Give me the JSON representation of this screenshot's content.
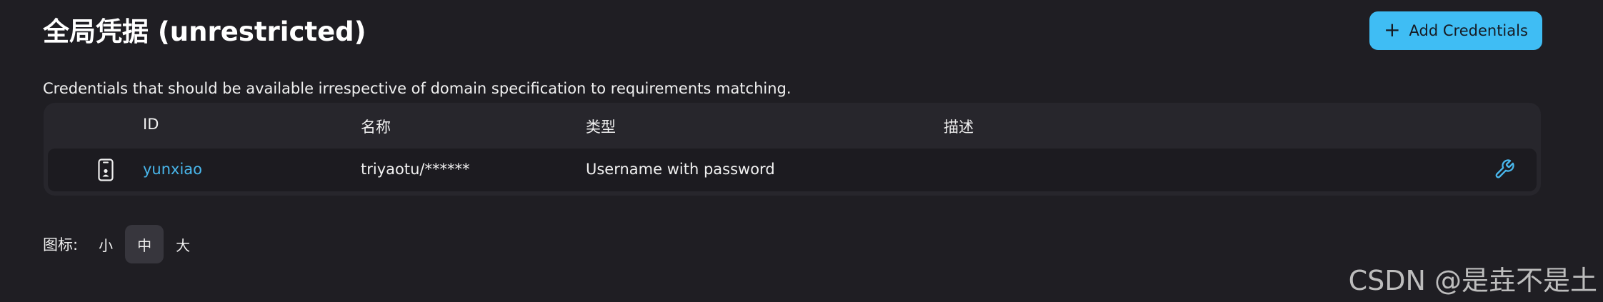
{
  "header": {
    "title": "全局凭据 (unrestricted)",
    "add_button_label": "Add Credentials",
    "add_button_icon": "plus-icon"
  },
  "description": "Credentials that should be available irrespective of domain specification to requirements matching.",
  "table": {
    "columns": [
      "ID",
      "名称",
      "类型",
      "描述"
    ],
    "rows": [
      {
        "icon": "mobile-credential-icon",
        "id": "yunxiao",
        "name": "triyaotu/******",
        "type": "Username with password",
        "description": "",
        "action_icon": "wrench-icon"
      }
    ]
  },
  "icon_size": {
    "label": "图标:",
    "options": [
      "小",
      "中",
      "大"
    ],
    "selected": "中"
  },
  "watermark": "CSDN @是垚不是土",
  "colors": {
    "background": "#1f1e23",
    "accent": "#3fbdf4",
    "link": "#49b7ec",
    "table_bg": "#27262c",
    "row_bg": "#1c1b20"
  }
}
